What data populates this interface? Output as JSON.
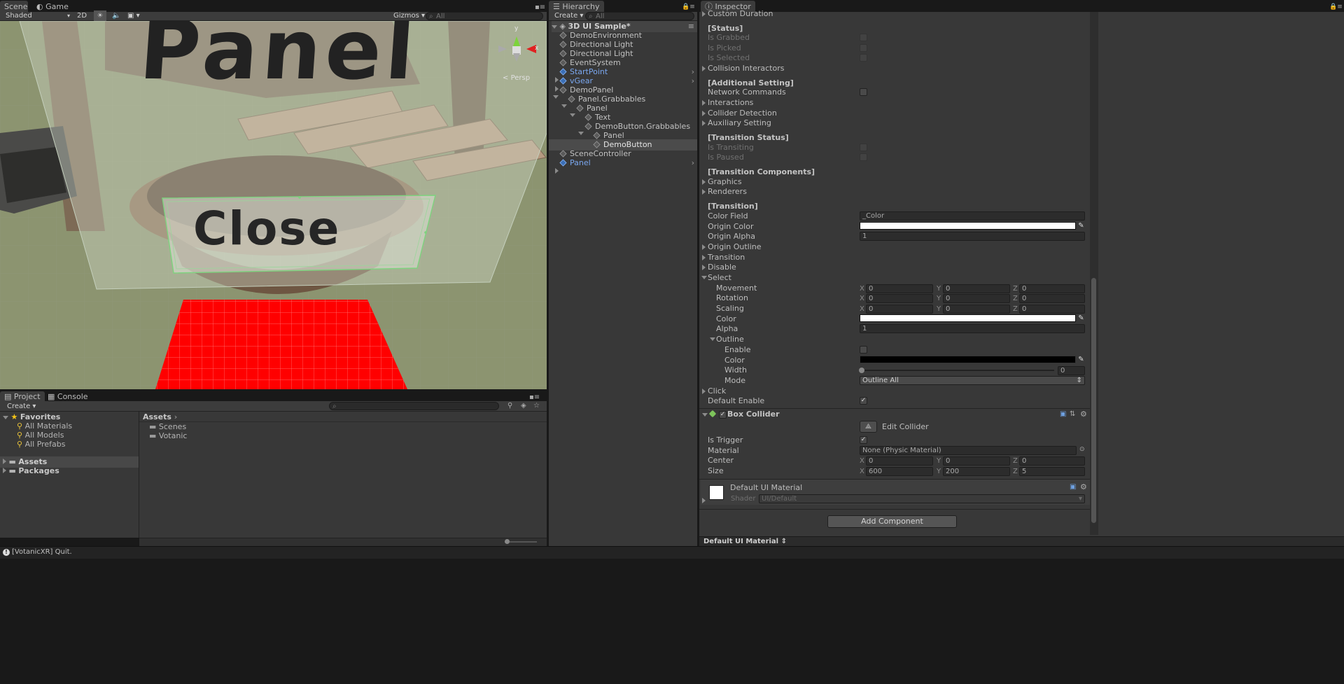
{
  "scene_tabs": {
    "scene": "Scene",
    "game": "Game"
  },
  "scene_toolbar": {
    "shading": "Shaded",
    "mode2d": "2D",
    "gizmos": "Gizmos",
    "search_placeholder": "All"
  },
  "viewport": {
    "panel_title": "Panel",
    "button_label": "Close",
    "persp": "Persp",
    "gizmo_axis_y": "y",
    "gizmo_axis_x": "x"
  },
  "hierarchy": {
    "tab": "Hierarchy",
    "create": "Create",
    "search_placeholder": "All",
    "scene_name": "3D UI Sample*",
    "items": [
      {
        "label": "DemoEnvironment",
        "prefab": false
      },
      {
        "label": "Directional Light",
        "prefab": false
      },
      {
        "label": "Directional Light",
        "prefab": false
      },
      {
        "label": "EventSystem",
        "prefab": false
      },
      {
        "label": "StartPoint",
        "prefab": true
      },
      {
        "label": "vGear",
        "prefab": true
      },
      {
        "label": "DemoPanel",
        "prefab": false
      },
      {
        "label": "Panel.Grabbables",
        "prefab": false
      },
      {
        "label": "Panel",
        "prefab": false
      },
      {
        "label": "Text",
        "prefab": false
      },
      {
        "label": "DemoButton.Grabbables",
        "prefab": false
      },
      {
        "label": "Panel",
        "prefab": false
      },
      {
        "label": "DemoButton",
        "prefab": false,
        "selected": true
      },
      {
        "label": "SceneController",
        "prefab": false
      },
      {
        "label": "Panel",
        "prefab": true
      }
    ]
  },
  "project": {
    "tabs": {
      "project": "Project",
      "console": "Console"
    },
    "create": "Create",
    "favorites": "Favorites",
    "favorite_items": [
      "All Materials",
      "All Models",
      "All Prefabs"
    ],
    "roots": [
      "Assets",
      "Packages"
    ],
    "breadcrumb": "Assets",
    "folders": [
      "Scenes",
      "Votanic"
    ]
  },
  "inspector": {
    "tab": "Inspector",
    "custom_duration": "Custom Duration",
    "status_header": "[Status]",
    "status": {
      "grabbed": "Is Grabbed",
      "picked": "Is Picked",
      "selected": "Is Selected",
      "collision": "Collision Interactors"
    },
    "additional_header": "[Additional Setting]",
    "additional": {
      "network": "Network Commands",
      "interactions": "Interactions",
      "collider_detection": "Collider Detection",
      "auxiliary": "Auxiliary Setting"
    },
    "transition_status_header": "[Transition Status]",
    "transition_status": {
      "transiting": "Is Transiting",
      "paused": "Is Paused"
    },
    "transition_components_header": "[Transition Components]",
    "transition_components": {
      "graphics": "Graphics",
      "renderers": "Renderers"
    },
    "transition_header": "[Transition]",
    "transition": {
      "color_field": "Color Field",
      "color_field_value": "_Color",
      "origin_color": "Origin Color",
      "origin_alpha": "Origin Alpha",
      "origin_alpha_value": "1",
      "origin_outline": "Origin Outline",
      "transition": "Transition",
      "disable": "Disable",
      "select": "Select",
      "movement": "Movement",
      "rotation": "Rotation",
      "scaling": "Scaling",
      "vec_zero": "0",
      "x": "X",
      "y": "Y",
      "z": "Z",
      "color": "Color",
      "alpha": "Alpha",
      "alpha_value": "1",
      "outline": "Outline",
      "enable": "Enable",
      "outline_color": "Color",
      "width": "Width",
      "width_value": "0",
      "mode": "Mode",
      "mode_value": "Outline All",
      "click": "Click",
      "default_enable": "Default Enable"
    },
    "box_collider": {
      "title": "Box Collider",
      "edit_collider": "Edit Collider",
      "is_trigger": "Is Trigger",
      "material": "Material",
      "material_value": "None (Physic Material)",
      "center": "Center",
      "center_x": "0",
      "center_y": "0",
      "center_z": "0",
      "size": "Size",
      "size_x": "600",
      "size_y": "200",
      "size_z": "5"
    },
    "material": {
      "name": "Default UI Material",
      "shader_label": "Shader",
      "shader_value": "UI/Default"
    },
    "add_component": "Add Component",
    "footer_label": "Default UI Material"
  },
  "status_bar": {
    "message": "[VotanicXR] Quit."
  },
  "colors": {
    "bg": "#383838",
    "selection": "#3e5f96",
    "prefab_blue": "#7aa7ef",
    "red_floor": "#ff0000"
  }
}
